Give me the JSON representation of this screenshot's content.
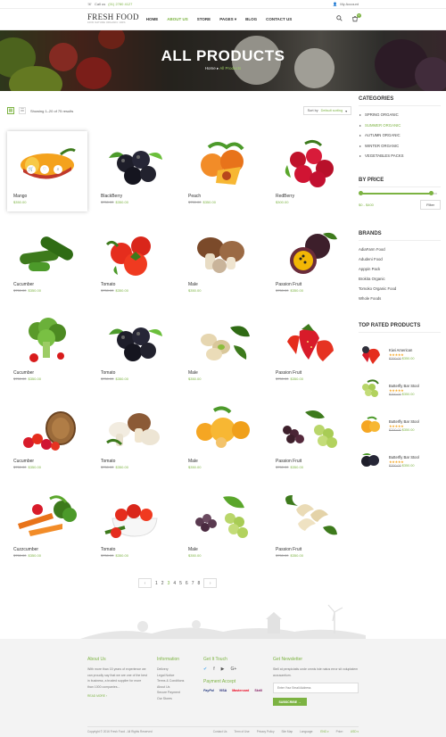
{
  "topbar": {
    "phone_label": "Call us",
    "phone": "(01) 2780 4127",
    "account": "My Account"
  },
  "header": {
    "logo_name": "FRESH FOOD",
    "logo_tagline": "100% NATURE ORGANIC 100%",
    "nav": [
      {
        "label": "HOME"
      },
      {
        "label": "ABOUT US"
      },
      {
        "label": "STORE"
      },
      {
        "label": "PAGES ▾"
      },
      {
        "label": "BLOG"
      },
      {
        "label": "CONTACT US"
      }
    ],
    "cart_count": "0"
  },
  "hero": {
    "title": "ALL PRODUCTS",
    "crumb_home": "Home",
    "crumb_sep": "▸",
    "crumb_current": "All Products"
  },
  "toolbar": {
    "showing": "Showing 1–20 of 75 results",
    "sort_label": "Sort by",
    "sort_value": "Default sorting"
  },
  "products": [
    {
      "name": "Mango",
      "old": "",
      "price": "$350.00",
      "icon": "mango"
    },
    {
      "name": "BlackBerry",
      "old": "$750.00",
      "price": "$350.00",
      "icon": "blackberry"
    },
    {
      "name": "Peach",
      "old": "$750.00",
      "price": "$350.00",
      "icon": "peach"
    },
    {
      "name": "RedBerry",
      "old": "",
      "price": "$300.00",
      "icon": "redberry"
    },
    {
      "name": "Cucumber",
      "old": "$750.00",
      "price": "$350.00",
      "icon": "cucumber"
    },
    {
      "name": "Tomato",
      "old": "$750.00",
      "price": "$350.00",
      "icon": "tomato"
    },
    {
      "name": "Male",
      "old": "",
      "price": "$350.00",
      "icon": "mushroom"
    },
    {
      "name": "Passion Fruit",
      "old": "$750.00",
      "price": "$350.00",
      "icon": "passion"
    },
    {
      "name": "Cucumber",
      "old": "$750.00",
      "price": "$350.00",
      "icon": "broccoli"
    },
    {
      "name": "Tomato",
      "old": "$750.00",
      "price": "$350.00",
      "icon": "blackberry"
    },
    {
      "name": "Male",
      "old": "",
      "price": "$350.00",
      "icon": "pistachio"
    },
    {
      "name": "Passion Fruit",
      "old": "$750.00",
      "price": "$350.00",
      "icon": "strawberry"
    },
    {
      "name": "Cucumber",
      "old": "$750.00",
      "price": "$350.00",
      "icon": "basket"
    },
    {
      "name": "Tomato",
      "old": "$750.00",
      "price": "$350.00",
      "icon": "mushroom2"
    },
    {
      "name": "Male",
      "old": "",
      "price": "$350.00",
      "icon": "apricot"
    },
    {
      "name": "Passion Fruit",
      "old": "$750.00",
      "price": "$350.00",
      "icon": "grapes"
    },
    {
      "name": "Cuzzcumber",
      "old": "$750.00",
      "price": "$350.00",
      "icon": "veggies"
    },
    {
      "name": "Tomato",
      "old": "$750.00",
      "price": "$350.00",
      "icon": "tomatobowl"
    },
    {
      "name": "Male",
      "old": "",
      "price": "$350.00",
      "icon": "grapes2"
    },
    {
      "name": "Passion Fruit",
      "old": "$750.00",
      "price": "$350.00",
      "icon": "cashew"
    }
  ],
  "pagination": {
    "prev": "‹",
    "next": "›",
    "pages": [
      "1",
      "2",
      "3",
      "4",
      "5",
      "6",
      "7",
      "8"
    ],
    "current": "3"
  },
  "sidebar": {
    "categories_title": "CATEGORIES",
    "categories": [
      "SPRING ORGANIC",
      "SUMMER ORGANIC",
      "AUTUMN ORGANIC",
      "WINTER ORGANIC",
      "VEGETABLES PACKS"
    ],
    "active_category": "SUMMER ORGANIC",
    "price_title": "BY PRICE",
    "price_range": "$0 - $400",
    "filter_label": "Filter",
    "brands_title": "BRANDS",
    "brands": [
      "AdiaFarm Food",
      "Adudeni Food",
      "Apppin Pack",
      "Brokita Organic",
      "Tomoko Organic Food",
      "Whole Foods"
    ],
    "top_title": "TOP RATED PRODUCTS",
    "top": [
      {
        "name": "Kiwi American",
        "stars": "★★★★★",
        "old": "$700.00",
        "price": "$350.00",
        "icon": "strawberry-sm"
      },
      {
        "name": "Butterfly Bar Stool",
        "stars": "★★★★★",
        "old": "$700.00",
        "price": "$350.00",
        "icon": "grapes-sm"
      },
      {
        "name": "Butterfly Bar Stool",
        "stars": "★★★★★",
        "old": "$700.00",
        "price": "$350.00",
        "icon": "apricot-sm"
      },
      {
        "name": "Butterfly Bar Stool",
        "stars": "★★★★★",
        "old": "$700.00",
        "price": "$350.00",
        "icon": "blackberry-sm"
      }
    ]
  },
  "footer": {
    "about_title": "About Us",
    "about_text": "With more than 15 years of experience we can proudly say that we are one of the best in business, a trusted supplier for more than 1000 companies...",
    "more": "READ MORE ›",
    "info_title": "Information",
    "info_links": [
      "Delivery",
      "Legal Notice",
      "Terms & Conditions",
      "About Us",
      "Secure Payment",
      "Our Stores"
    ],
    "touch_title": "Get It Touch",
    "social": [
      "✔",
      "f",
      "▶",
      "G+"
    ],
    "payment_title": "Payment Accept",
    "payment": [
      "PayPal",
      "VISA",
      "Mastercard",
      "Skrill"
    ],
    "news_title": "Get Newsletter",
    "news_text": "Stell at perspiciatis unde omnis iste natus error sit voluptatem accusantium.",
    "email_placeholder": "Enter Your Email Address",
    "subscribe": "SUBSCRIBE →",
    "copyright": "Copyright © 2016 Fresh Food - All Rights Reserved",
    "links": [
      "Contact Us",
      "Term of Use",
      "Privacy Policy",
      "Site Map"
    ],
    "language_label": "Language:",
    "language": "ENG ▾",
    "price_label": "Price:",
    "currency": "USD ▾"
  }
}
